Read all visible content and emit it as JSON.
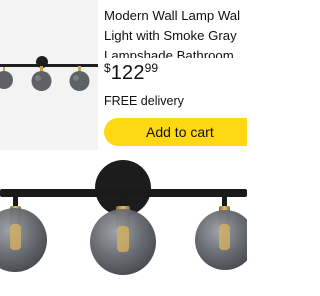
{
  "product": {
    "title_line1": "Modern Wall Lamp Wal",
    "title_line2": "Light with Smoke Gray",
    "title_line3": "Lampshade Bathroom",
    "price_currency": "$",
    "price_whole": "122",
    "price_fraction": "99",
    "delivery": "FREE delivery",
    "add_to_cart_label": "Add to cart"
  },
  "colors": {
    "accent": "#ffd814",
    "text": "#0f1111",
    "smoke_glass": "#5b5e63",
    "brass": "#c9a24a"
  }
}
